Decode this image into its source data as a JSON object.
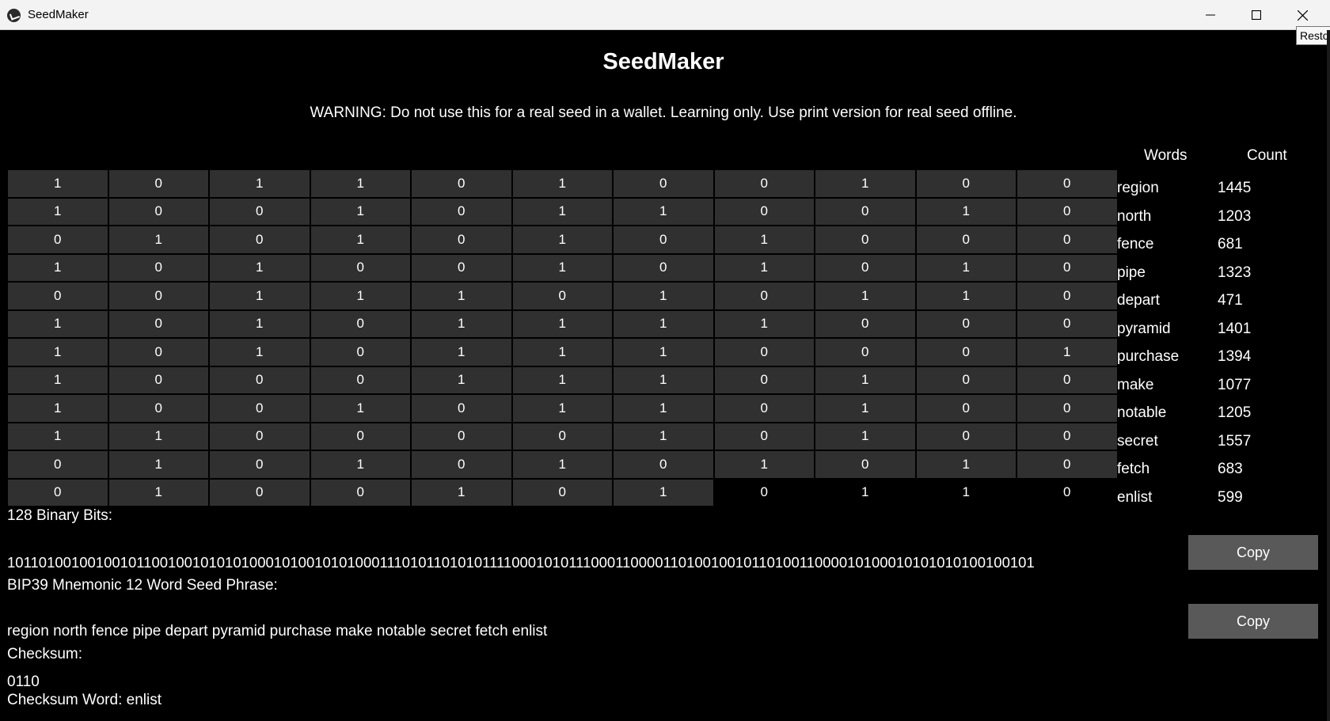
{
  "window": {
    "title": "SeedMaker",
    "tooltip": "Restore"
  },
  "header": {
    "title": "SeedMaker",
    "warning": "WARNING: Do not use this for a real seed in a wallet. Learning only. Use print version for real seed offline."
  },
  "grid": {
    "rows": [
      [
        "1",
        "0",
        "1",
        "1",
        "0",
        "1",
        "0",
        "0",
        "1",
        "0",
        "0"
      ],
      [
        "1",
        "0",
        "0",
        "1",
        "0",
        "1",
        "1",
        "0",
        "0",
        "1",
        "0"
      ],
      [
        "0",
        "1",
        "0",
        "1",
        "0",
        "1",
        "0",
        "1",
        "0",
        "0",
        "0"
      ],
      [
        "1",
        "0",
        "1",
        "0",
        "0",
        "1",
        "0",
        "1",
        "0",
        "1",
        "0"
      ],
      [
        "0",
        "0",
        "1",
        "1",
        "1",
        "0",
        "1",
        "0",
        "1",
        "1",
        "0"
      ],
      [
        "1",
        "0",
        "1",
        "0",
        "1",
        "1",
        "1",
        "1",
        "0",
        "0",
        "0"
      ],
      [
        "1",
        "0",
        "1",
        "0",
        "1",
        "1",
        "1",
        "0",
        "0",
        "0",
        "1"
      ],
      [
        "1",
        "0",
        "0",
        "0",
        "1",
        "1",
        "1",
        "0",
        "1",
        "0",
        "0"
      ],
      [
        "1",
        "0",
        "0",
        "1",
        "0",
        "1",
        "1",
        "0",
        "1",
        "0",
        "0"
      ],
      [
        "1",
        "1",
        "0",
        "0",
        "0",
        "0",
        "1",
        "0",
        "1",
        "0",
        "0"
      ],
      [
        "0",
        "1",
        "0",
        "1",
        "0",
        "1",
        "0",
        "1",
        "0",
        "1",
        "0"
      ],
      [
        "0",
        "1",
        "0",
        "0",
        "1",
        "0",
        "1",
        "0",
        "1",
        "1",
        "0"
      ]
    ],
    "last_row_button_count": 7
  },
  "words_table": {
    "header_words": "Words",
    "header_count": "Count",
    "rows": [
      {
        "word": "region",
        "count": "1445"
      },
      {
        "word": "north",
        "count": "1203"
      },
      {
        "word": "fence",
        "count": "681"
      },
      {
        "word": "pipe",
        "count": "1323"
      },
      {
        "word": "depart",
        "count": "471"
      },
      {
        "word": "pyramid",
        "count": "1401"
      },
      {
        "word": "purchase",
        "count": "1394"
      },
      {
        "word": "make",
        "count": "1077"
      },
      {
        "word": "notable",
        "count": "1205"
      },
      {
        "word": "secret",
        "count": "1557"
      },
      {
        "word": "fetch",
        "count": "683"
      },
      {
        "word": "enlist",
        "count": "599"
      }
    ]
  },
  "output": {
    "bits_label": "128 Binary Bits:",
    "bits_value": "10110100100100101100100101010100010100101010001110101101010111100010101110001100001101001001011010011000010100010101010100100101",
    "mnemonic_label": "BIP39 Mnemonic 12 Word Seed Phrase:",
    "mnemonic_value": "region north fence pipe depart pyramid purchase make notable secret fetch enlist",
    "checksum_label": "Checksum:",
    "checksum_value": "0110",
    "checksum_word": "Checksum Word: enlist",
    "copy_label": "Copy"
  }
}
